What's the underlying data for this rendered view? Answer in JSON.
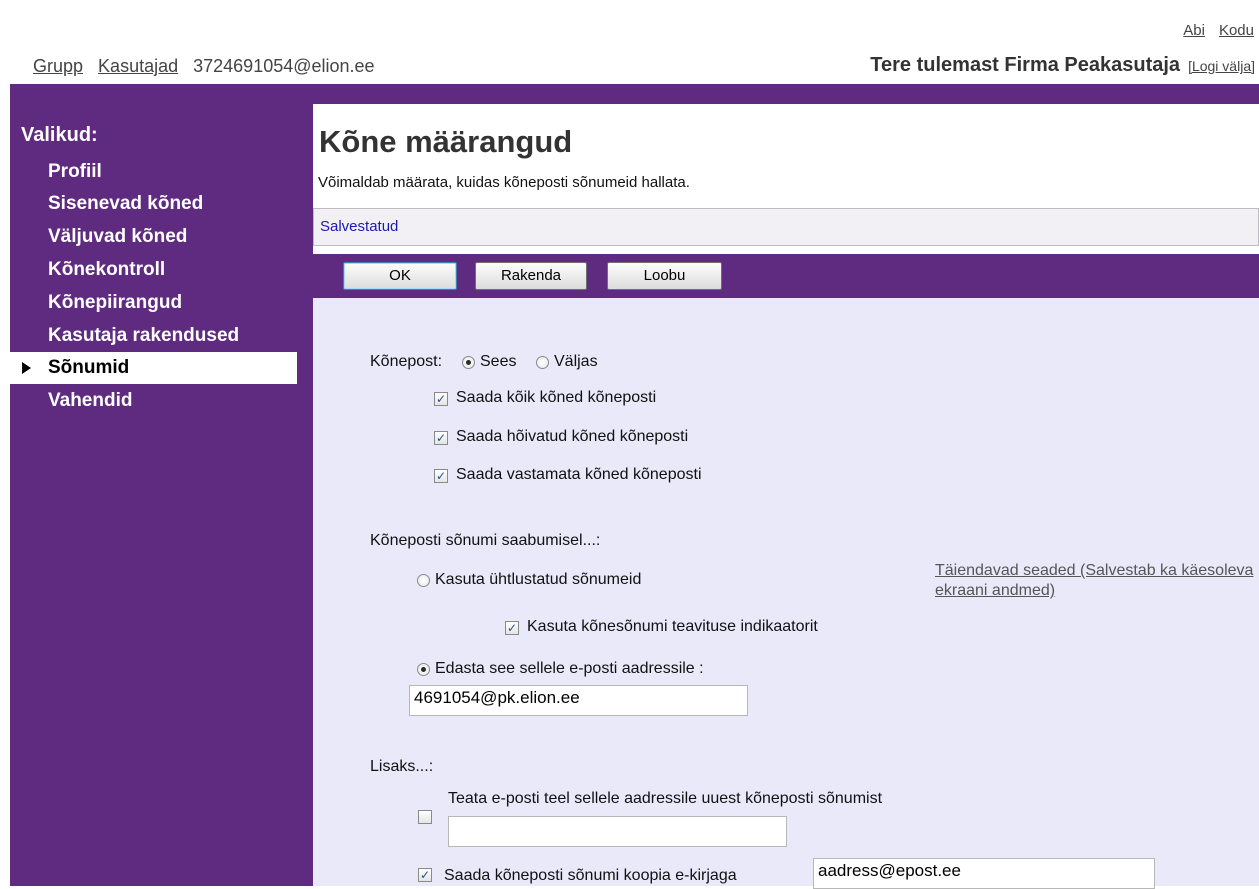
{
  "top_links": {
    "help": "Abi",
    "home": "Kodu"
  },
  "nav": {
    "group": "Grupp",
    "users": "Kasutajad",
    "account": "3724691054@elion.ee"
  },
  "welcome": {
    "text": "Tere tulemast Firma Peakasutaja",
    "logout": "[Logi välja]"
  },
  "sidebar": {
    "title": "Valikud:",
    "items": [
      "Profiil",
      "Sisenevad kõned",
      "Väljuvad kõned",
      "Kõnekontroll",
      "Kõnepiirangud",
      "Kasutaja rakendused",
      "Sõnumid",
      "Vahendid"
    ],
    "active": "Sõnumid"
  },
  "page": {
    "title": "Kõne määrangud",
    "description": "Võimaldab määrata, kuidas kõneposti sõnumeid hallata.",
    "status": "Salvestatud"
  },
  "buttons": {
    "ok": "OK",
    "apply": "Rakenda",
    "cancel": "Loobu"
  },
  "voicemail": {
    "label": "Kõnepost:",
    "on": "Sees",
    "off": "Väljas",
    "selected": "Sees",
    "send_all": "Saada kõik kõned kõneposti",
    "send_busy": "Saada hõivatud kõned kõneposti",
    "send_unanswered": "Saada vastamata kõned kõneposti"
  },
  "arrival": {
    "label": "Kõneposti sõnumi saabumisel...:",
    "unified": "Kasuta ühtlustatud sõnumeid",
    "indicator": "Kasuta kõnesõnumi teavituse indikaatorit",
    "forward": "Edasta see sellele e-posti aadressile :",
    "forward_email": "4691054@pk.elion.ee",
    "selected": "forward",
    "more_settings": "Täiendavad seaded (Salvestab ka käesoleva ekraani andmed)"
  },
  "additional": {
    "label": "Lisaks...:",
    "notify": "Teata e-posti teel sellele aadressile uuest kõneposti sõnumist",
    "notify_email": "",
    "copy": "Saada kõneposti sõnumi koopia e-kirjaga",
    "copy_email": "aadress@epost.ee"
  },
  "colors": {
    "brand_purple": "#5f2b80",
    "form_bg": "#e9e9f9",
    "status_text": "#1a1ab0"
  }
}
